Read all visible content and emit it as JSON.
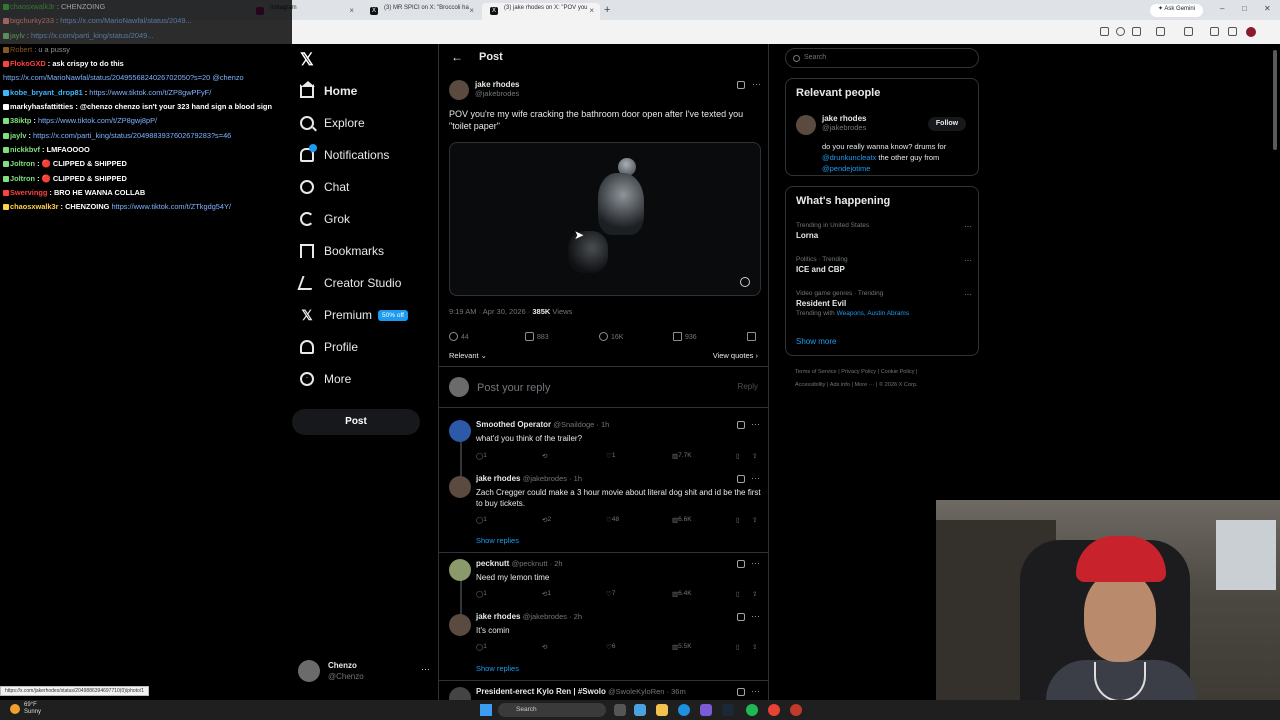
{
  "browser": {
    "tabs": [
      {
        "title": "Instagram"
      },
      {
        "title": "(3) MR SPICI on X: \"Broccoli ha"
      },
      {
        "title": "(3) jake rhodes on X: \"POV you"
      }
    ],
    "new_tab": "+",
    "ask_gemini": "Ask Gemini",
    "status_url": "https://x.com/jakerhodes/status/2049886394697710(0)/photo/1"
  },
  "chat": {
    "lines": [
      {
        "user": "chaosxwalk3r",
        "user_color": "#3db83d",
        "msg": "CHENZOING",
        "link": "",
        "blurred": true
      },
      {
        "user": "bigchurky233",
        "user_color": "#ff9090",
        "msg": "",
        "link": "https://x.com/MarioNawfal/status/2049...",
        "blurred": true
      },
      {
        "user": "jaylv",
        "user_color": "#7fe07f",
        "msg": "",
        "link": "https://x.com/parti_king/status/2049...",
        "blurred": true
      },
      {
        "user": "Robert",
        "user_color": "#f0a040",
        "msg": "u a pussy",
        "link": "",
        "blurred": true
      },
      {
        "user": "FlokoGXD",
        "user_color": "#ff4040",
        "msg": "ask crispy to do this",
        "link": "",
        "blurred": false
      },
      {
        "user": "",
        "user_color": "#ffffff",
        "msg": "",
        "link": "https://x.com/MarioNawfal/status/2049556824026702050?s=20 @chenzo",
        "blurred": false
      },
      {
        "user": "kobe_bryant_drop81",
        "user_color": "#3db8ff",
        "msg": "",
        "link": "https://www.tiktok.com/t/ZP8gwPFyF/",
        "blurred": false
      },
      {
        "user": "markyhasfattitties",
        "user_color": "#ffffff",
        "msg": "@chenzo chenzo isn't your 323 hand sign a blood sign",
        "link": "",
        "blurred": false
      },
      {
        "user": "38iktp",
        "user_color": "#7fe07f",
        "msg": "",
        "link": "https://www.tiktok.com/t/ZP8gwj8pP/",
        "blurred": false
      },
      {
        "user": "jaylv",
        "user_color": "#7fe07f",
        "msg": "",
        "link": "https://x.com/parti_king/status/2049883937602679283?s=46",
        "blurred": false
      },
      {
        "user": "nickkbvf",
        "user_color": "#7fe07f",
        "msg": "LMFAOOOO",
        "link": "",
        "blurred": false
      },
      {
        "user": "Joltron",
        "user_color": "#7fe07f",
        "msg": "🔴 CLIPPED & SHIPPED",
        "link": "",
        "blurred": false
      },
      {
        "user": "Joltron",
        "user_color": "#7fe07f",
        "msg": "🔴 CLIPPED & SHIPPED",
        "link": "",
        "blurred": false
      },
      {
        "user": "Swervingg",
        "user_color": "#ff4040",
        "msg": "BRO HE WANNA COLLAB",
        "link": "",
        "blurred": false
      },
      {
        "user": "chaosxwalk3r",
        "user_color": "#ffd24a",
        "msg": "CHENZOING",
        "link": "https://www.tiktok.com/t/ZTkgdg54Y/",
        "blurred": false
      }
    ]
  },
  "nav": {
    "items": [
      {
        "label": "Home",
        "icon": "home-icon"
      },
      {
        "label": "Explore",
        "icon": "search-icon"
      },
      {
        "label": "Notifications",
        "icon": "bell-icon"
      },
      {
        "label": "Chat",
        "icon": "chat-icon"
      },
      {
        "label": "Grok",
        "icon": "grok-icon"
      },
      {
        "label": "Bookmarks",
        "icon": "bookmark-icon"
      },
      {
        "label": "Creator Studio",
        "icon": "creator-studio-icon"
      },
      {
        "label": "Premium",
        "icon": "x-premium-icon"
      },
      {
        "label": "Profile",
        "icon": "profile-icon"
      },
      {
        "label": "More",
        "icon": "more-circle-icon"
      }
    ],
    "premium_badge": "50% off",
    "post_button": "Post",
    "account": {
      "name": "Chenzo",
      "handle": "@Chenzo",
      "more": "···"
    }
  },
  "post": {
    "header_title": "Post",
    "author_name": "jake rhodes",
    "author_handle": "@jakebrodes",
    "text": "POV you're my wife cracking the bathroom door open after I've texted you \"toilet paper\"",
    "time": "9:19 AM · Apr 30, 2026 · ",
    "views_count": "385K",
    "views_label": " Views",
    "stats": {
      "replies": "44",
      "reposts": "883",
      "likes": "16K",
      "bookmarks": "936"
    },
    "sort_label": "Relevant ⌄",
    "view_quotes": "View quotes ›",
    "reply_placeholder": "Post your reply",
    "reply_button": "Reply"
  },
  "replies": [
    {
      "name": "Smoothed Operator",
      "handle": "@Snaildoge · 1h",
      "text": "what'd you think of the trailer?",
      "stats": [
        "1",
        "",
        "1",
        "7.7K"
      ]
    },
    {
      "name": "jake rhodes",
      "handle": "@jakebrodes · 1h",
      "text": "Zach Cregger could make a 3 hour movie about literal dog shit and id be the first to buy tickets.",
      "stats": [
        "1",
        "2",
        "48",
        "6.6K"
      ]
    },
    {
      "name": "pecknutt",
      "handle": "@pecknutt · 2h",
      "text": "Need my lemon time",
      "stats": [
        "1",
        "1",
        "7",
        "6.4K"
      ]
    },
    {
      "name": "jake rhodes",
      "handle": "@jakebrodes · 2h",
      "text": "It's comin",
      "stats": [
        "1",
        "",
        "6",
        "5.5K"
      ]
    },
    {
      "name": "President-erect Kylo Ren | #Swolo",
      "handle": "@SwoleKyloRen · 36m",
      "text": "",
      "stats": []
    }
  ],
  "show_replies": "Show replies",
  "right": {
    "search_placeholder": "Search",
    "relevant_title": "Relevant people",
    "person": {
      "name": "jake rhodes",
      "handle": "@jakebrodes",
      "follow": "Follow",
      "bio_1": "do you really wanna know? drums for ",
      "bio_link1": "@drunkuncleatx",
      "bio_2": " the other guy from ",
      "bio_link2": "@pendejotime"
    },
    "happening_title": "What's happening",
    "trends": [
      {
        "context": "Trending in United States",
        "name": "Lorna",
        "with": "",
        "links": ""
      },
      {
        "context": "Politics · Trending",
        "name": "ICE and CBP",
        "with": "",
        "links": ""
      },
      {
        "context": "Video game genres · Trending",
        "name": "Resident Evil",
        "with": "Trending with ",
        "links": "Weapons, Austin Abrams"
      }
    ],
    "show_more": "Show more",
    "footer": [
      "Terms of Service",
      "Privacy Policy",
      "Cookie Policy",
      "Accessibility",
      "Ads info",
      "More ···",
      "© 2026 X Corp."
    ]
  },
  "taskbar": {
    "weather_temp": "69°F",
    "weather_desc": "Sunny",
    "search_placeholder": "Search"
  }
}
